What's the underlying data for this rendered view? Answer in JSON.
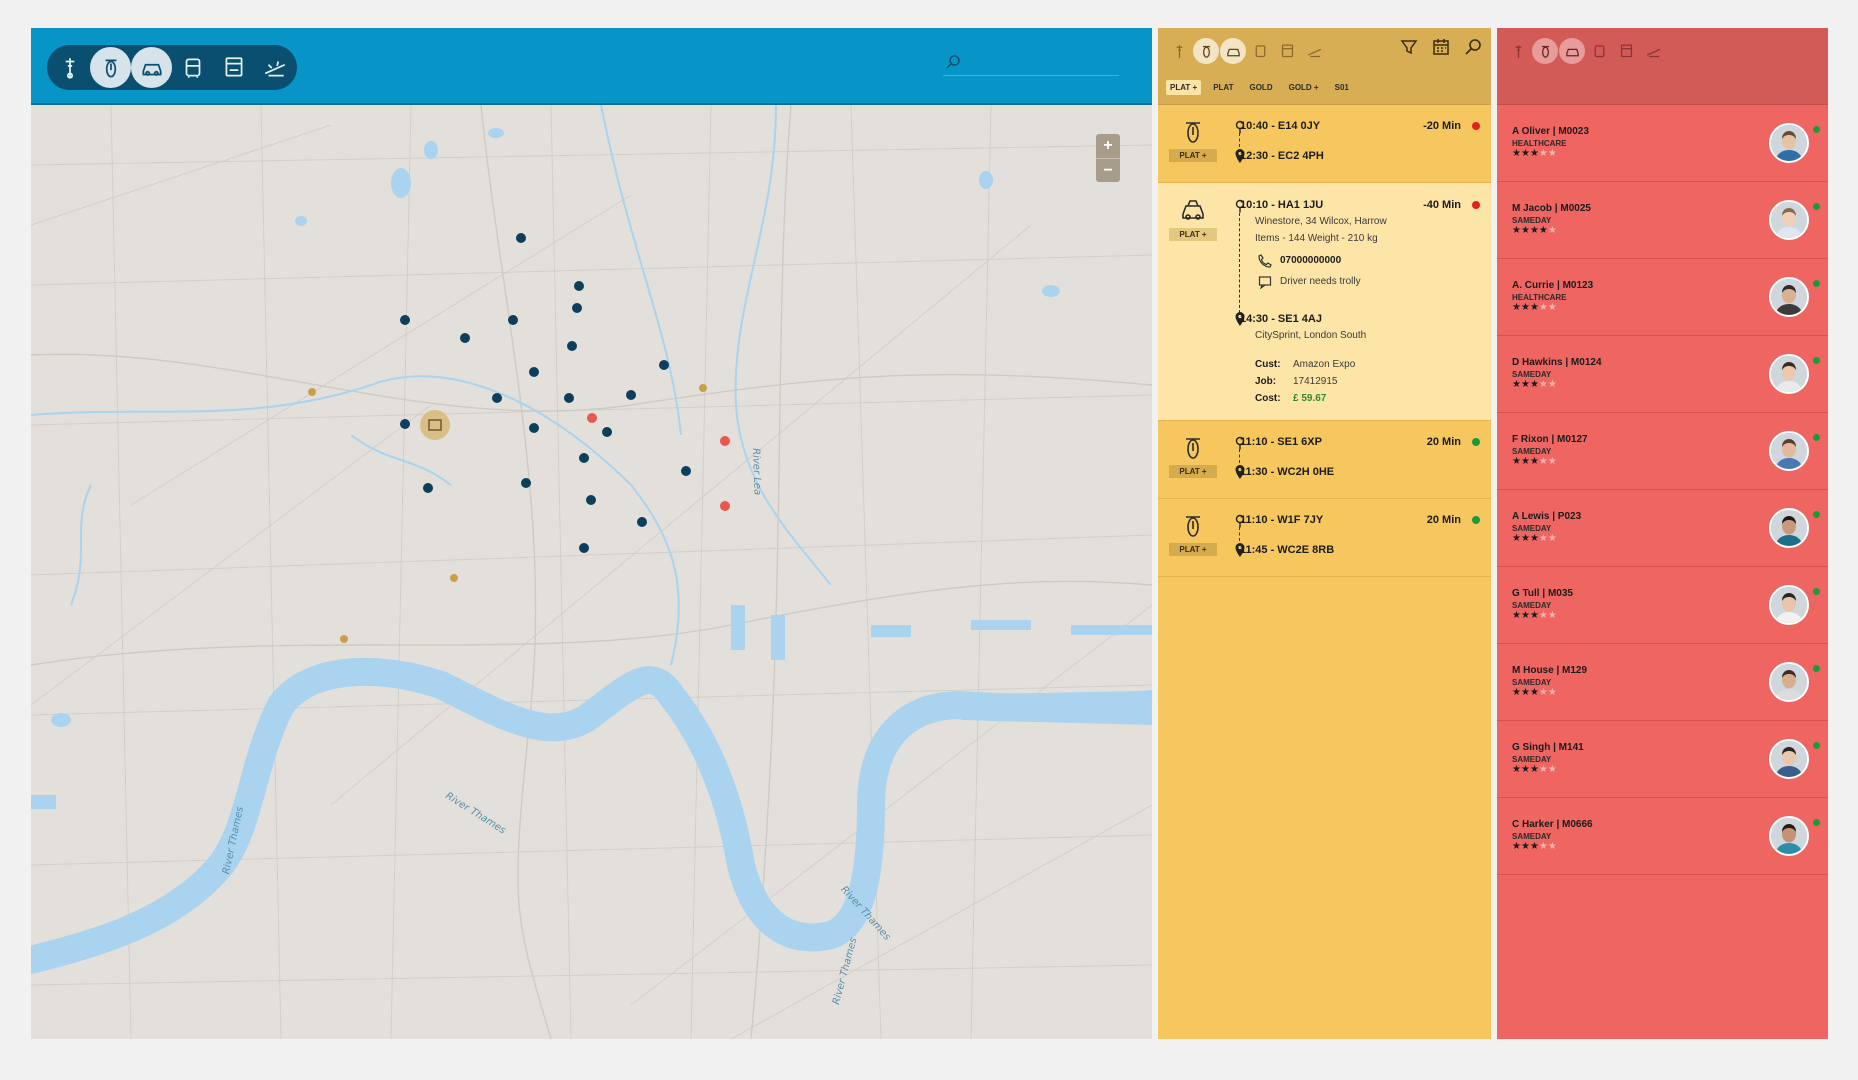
{
  "map": {
    "vehicle_tabs": [
      {
        "icon": "bicycle-icon",
        "active": false
      },
      {
        "icon": "scooter-icon",
        "active": true
      },
      {
        "icon": "car-icon",
        "active": true
      },
      {
        "icon": "van-icon",
        "active": false
      },
      {
        "icon": "truck-icon",
        "active": false
      },
      {
        "icon": "plane-icon",
        "active": false
      }
    ],
    "search_placeholder": "",
    "zoom_in": "+",
    "zoom_out": "−",
    "labels": {
      "river_thames_1": "River Thames",
      "river_thames_2": "River Thames",
      "river_thames_3": "River Thames",
      "river_thames_4": "River Thames",
      "river_lea": "River Lea"
    }
  },
  "jobs": {
    "filters": [
      "PLAT +",
      "PLAT",
      "GOLD",
      "GOLD +",
      "S01"
    ],
    "active_filter": "PLAT +",
    "cards": [
      {
        "vehicle": "scooter",
        "badge": "PLAT +",
        "pickup": "10:40 - E14 0JY",
        "dropoff": "12:30 - EC2 4PH",
        "eta": "-20 Min",
        "status_color": "#e42020"
      },
      {
        "vehicle": "car",
        "badge": "PLAT +",
        "pickup": "10:10 - HA1 1JU",
        "pickup_address": "Winestore, 34 Wilcox, Harrow",
        "items_line": "Items - 144   Weight  - 210 kg",
        "phone": "07000000000",
        "note": "Driver needs trolly",
        "dropoff": "14:30 - SE1 4AJ",
        "dropoff_address": "CitySprint, London South",
        "cust_label": "Cust:",
        "cust_value": "Amazon Expo",
        "job_label": "Job:",
        "job_value": "17412915",
        "cost_label": "Cost:",
        "cost_value": "£ 59.67",
        "eta": "-40 Min",
        "status_color": "#e42020"
      },
      {
        "vehicle": "scooter",
        "badge": "PLAT +",
        "pickup": "11:10 - SE1 6XP",
        "dropoff": "11:30 - WC2H 0HE",
        "eta": "20 Min",
        "status_color": "#1a9a3a"
      },
      {
        "vehicle": "scooter",
        "badge": "PLAT +",
        "pickup": "11:10 - W1F 7JY",
        "dropoff": "11:45 - WC2E 8RB",
        "eta": "20 Min",
        "status_color": "#1a9a3a"
      }
    ]
  },
  "drivers": {
    "list": [
      {
        "name": "A Oliver  | M0023",
        "category": "HEALTHCARE",
        "rating": 3,
        "max": 5
      },
      {
        "name": "M Jacob  | M0025",
        "category": "SAMEDAY",
        "rating": 4,
        "max": 5
      },
      {
        "name": "A. Currie | M0123",
        "category": "HEALTHCARE",
        "rating": 3,
        "max": 5
      },
      {
        "name": "D Hawkins | M0124",
        "category": "SAMEDAY",
        "rating": 3,
        "max": 5
      },
      {
        "name": "F Rixon | M0127",
        "category": "SAMEDAY",
        "rating": 3,
        "max": 5
      },
      {
        "name": "A Lewis  | P023",
        "category": "SAMEDAY",
        "rating": 3,
        "max": 5
      },
      {
        "name": "G Tull  | M035",
        "category": "SAMEDAY",
        "rating": 3,
        "max": 5
      },
      {
        "name": "M House  | M129",
        "category": "SAMEDAY",
        "rating": 3,
        "max": 5
      },
      {
        "name": "G Singh | M141",
        "category": "SAMEDAY",
        "rating": 3,
        "max": 5
      },
      {
        "name": "C Harker | M0666",
        "category": "SAMEDAY",
        "rating": 3,
        "max": 5
      }
    ]
  },
  "colors": {
    "map_header": "#0794c6",
    "jobs_panel": "#f7c75f",
    "drivers_panel": "#ee6562",
    "marker_blue": "#0d3f5c",
    "marker_gold": "#c9a04a",
    "marker_red": "#e8574e",
    "river": "#a9d3ee"
  }
}
